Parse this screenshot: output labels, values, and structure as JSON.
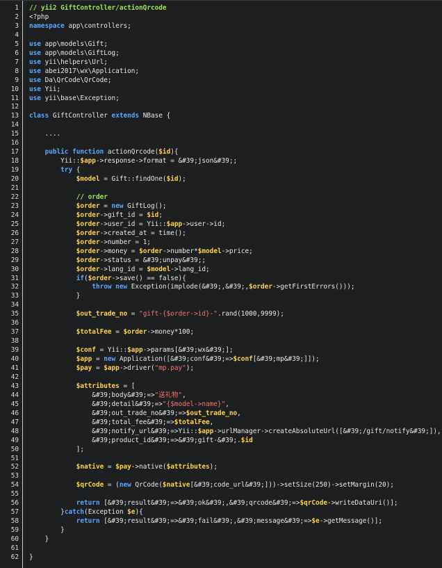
{
  "editor": {
    "colors": {
      "background": "#1d1f21",
      "text": "#e6e6e6",
      "keyword": "#59a8ff",
      "variable": "#ffd24a",
      "string": "#f4746a",
      "comment": "#9be84f",
      "line_number": "#d8d8d8"
    },
    "lines": [
      {
        "n": "1",
        "seg": [
          [
            "cm",
            "// yii2 GiftController/actionQrcode"
          ]
        ]
      },
      {
        "n": "2",
        "seg": [
          [
            "pl",
            "<?php"
          ]
        ]
      },
      {
        "n": "3",
        "seg": [
          [
            "kw",
            "namespace"
          ],
          [
            "pl",
            " app\\controllers;"
          ]
        ]
      },
      {
        "n": "4",
        "seg": []
      },
      {
        "n": "5",
        "seg": [
          [
            "kw",
            "use"
          ],
          [
            "pl",
            " app\\models\\Gift;"
          ]
        ]
      },
      {
        "n": "6",
        "seg": [
          [
            "kw",
            "use"
          ],
          [
            "pl",
            " app\\models\\GiftLog;"
          ]
        ]
      },
      {
        "n": "7",
        "seg": [
          [
            "kw",
            "use"
          ],
          [
            "pl",
            " yii\\helpers\\Url;"
          ]
        ]
      },
      {
        "n": "8",
        "seg": [
          [
            "kw",
            "use"
          ],
          [
            "pl",
            " abei2017\\wx\\Application;"
          ]
        ]
      },
      {
        "n": "9",
        "seg": [
          [
            "kw",
            "use"
          ],
          [
            "pl",
            " Da\\QrCode\\QrCode;"
          ]
        ]
      },
      {
        "n": "10",
        "seg": [
          [
            "kw",
            "use"
          ],
          [
            "pl",
            " Yii;"
          ]
        ]
      },
      {
        "n": "11",
        "seg": [
          [
            "kw",
            "use"
          ],
          [
            "pl",
            " yii\\base\\Exception;"
          ]
        ]
      },
      {
        "n": "12",
        "seg": []
      },
      {
        "n": "13",
        "seg": [
          [
            "kw",
            "class"
          ],
          [
            "pl",
            " GiftController "
          ],
          [
            "kw",
            "extends"
          ],
          [
            "pl",
            " NBase {"
          ]
        ]
      },
      {
        "n": "14",
        "seg": []
      },
      {
        "n": "15",
        "seg": [
          [
            "pl",
            "    ...."
          ]
        ]
      },
      {
        "n": "16",
        "seg": []
      },
      {
        "n": "17",
        "seg": [
          [
            "pl",
            "    "
          ],
          [
            "kw",
            "public function"
          ],
          [
            "pl",
            " actionQrcode("
          ],
          [
            "var",
            "$id"
          ],
          [
            "pl",
            "){"
          ]
        ]
      },
      {
        "n": "18",
        "seg": [
          [
            "pl",
            "        Yii::"
          ],
          [
            "var",
            "$app"
          ],
          [
            "pl",
            "->response->format = &#39;json&#39;;"
          ]
        ]
      },
      {
        "n": "19",
        "seg": [
          [
            "pl",
            "        "
          ],
          [
            "kw",
            "try"
          ],
          [
            "pl",
            " {"
          ]
        ]
      },
      {
        "n": "20",
        "seg": [
          [
            "pl",
            "            "
          ],
          [
            "var",
            "$model"
          ],
          [
            "pl",
            " = Gift::findOne("
          ],
          [
            "var",
            "$id"
          ],
          [
            "pl",
            ");"
          ]
        ]
      },
      {
        "n": "21",
        "seg": []
      },
      {
        "n": "22",
        "seg": [
          [
            "pl",
            "            "
          ],
          [
            "cm",
            "// order"
          ]
        ]
      },
      {
        "n": "23",
        "seg": [
          [
            "pl",
            "            "
          ],
          [
            "var",
            "$order"
          ],
          [
            "pl",
            " = "
          ],
          [
            "kw",
            "new"
          ],
          [
            "pl",
            " GiftLog();"
          ]
        ]
      },
      {
        "n": "24",
        "seg": [
          [
            "pl",
            "            "
          ],
          [
            "var",
            "$order"
          ],
          [
            "pl",
            "->gift_id = "
          ],
          [
            "var",
            "$id"
          ],
          [
            "pl",
            ";"
          ]
        ]
      },
      {
        "n": "25",
        "seg": [
          [
            "pl",
            "            "
          ],
          [
            "var",
            "$order"
          ],
          [
            "pl",
            "->user_id = Yii::"
          ],
          [
            "var",
            "$app"
          ],
          [
            "pl",
            "->user->id;"
          ]
        ]
      },
      {
        "n": "26",
        "seg": [
          [
            "pl",
            "            "
          ],
          [
            "var",
            "$order"
          ],
          [
            "pl",
            "->created_at = time();"
          ]
        ]
      },
      {
        "n": "27",
        "seg": [
          [
            "pl",
            "            "
          ],
          [
            "var",
            "$order"
          ],
          [
            "pl",
            "->number = 1;"
          ]
        ]
      },
      {
        "n": "28",
        "seg": [
          [
            "pl",
            "            "
          ],
          [
            "var",
            "$order"
          ],
          [
            "pl",
            "->money = "
          ],
          [
            "var",
            "$order"
          ],
          [
            "pl",
            "->number*"
          ],
          [
            "var",
            "$model"
          ],
          [
            "pl",
            "->price;"
          ]
        ]
      },
      {
        "n": "29",
        "seg": [
          [
            "pl",
            "            "
          ],
          [
            "var",
            "$order"
          ],
          [
            "pl",
            "->status = &#39;unpay&#39;;"
          ]
        ]
      },
      {
        "n": "30",
        "seg": [
          [
            "pl",
            "            "
          ],
          [
            "var",
            "$order"
          ],
          [
            "pl",
            "->lang_id = "
          ],
          [
            "var",
            "$model"
          ],
          [
            "pl",
            "->lang_id;"
          ]
        ]
      },
      {
        "n": "31",
        "seg": [
          [
            "pl",
            "            "
          ],
          [
            "kw",
            "if"
          ],
          [
            "pl",
            "("
          ],
          [
            "var",
            "$order"
          ],
          [
            "pl",
            "->save() == false){"
          ]
        ]
      },
      {
        "n": "32",
        "seg": [
          [
            "pl",
            "                "
          ],
          [
            "kw",
            "throw new"
          ],
          [
            "pl",
            " Exception(implode(&#39;,&#39;,"
          ],
          [
            "var",
            "$order"
          ],
          [
            "pl",
            "->getFirstErrors()));"
          ]
        ]
      },
      {
        "n": "33",
        "seg": [
          [
            "pl",
            "            }"
          ]
        ]
      },
      {
        "n": "34",
        "seg": []
      },
      {
        "n": "35",
        "seg": [
          [
            "pl",
            "            "
          ],
          [
            "var",
            "$out_trade_no"
          ],
          [
            "pl",
            " = "
          ],
          [
            "str",
            "\"gift-{$order->id}-\""
          ],
          [
            "pl",
            ".rand(1000,9999);"
          ]
        ]
      },
      {
        "n": "36",
        "seg": []
      },
      {
        "n": "37",
        "seg": [
          [
            "pl",
            "            "
          ],
          [
            "var",
            "$totalFee"
          ],
          [
            "pl",
            " = "
          ],
          [
            "var",
            "$order"
          ],
          [
            "pl",
            "->money*100;"
          ]
        ]
      },
      {
        "n": "38",
        "seg": []
      },
      {
        "n": "39",
        "seg": [
          [
            "pl",
            "            "
          ],
          [
            "var",
            "$conf"
          ],
          [
            "pl",
            " = Yii::"
          ],
          [
            "var",
            "$app"
          ],
          [
            "pl",
            "->params[&#39;wx&#39;];"
          ]
        ]
      },
      {
        "n": "40",
        "seg": [
          [
            "pl",
            "            "
          ],
          [
            "var",
            "$app"
          ],
          [
            "pl",
            " = "
          ],
          [
            "kw",
            "new"
          ],
          [
            "pl",
            " Application([&#39;conf&#39;=>"
          ],
          [
            "var",
            "$conf"
          ],
          [
            "pl",
            "[&#39;mp&#39;]]);"
          ]
        ]
      },
      {
        "n": "41",
        "seg": [
          [
            "pl",
            "            "
          ],
          [
            "var",
            "$pay"
          ],
          [
            "pl",
            " = "
          ],
          [
            "var",
            "$app"
          ],
          [
            "pl",
            "->driver("
          ],
          [
            "str",
            "\"mp.pay\""
          ],
          [
            "pl",
            ");"
          ]
        ]
      },
      {
        "n": "42",
        "seg": []
      },
      {
        "n": "43",
        "seg": [
          [
            "pl",
            "            "
          ],
          [
            "var",
            "$attributes"
          ],
          [
            "pl",
            " = ["
          ]
        ]
      },
      {
        "n": "44",
        "seg": [
          [
            "pl",
            "                &#39;body&#39;=>"
          ],
          [
            "str",
            "\"送礼物\""
          ],
          [
            "pl",
            ","
          ]
        ]
      },
      {
        "n": "45",
        "seg": [
          [
            "pl",
            "                &#39;detail&#39;=>"
          ],
          [
            "str",
            "\"{$model->name}\""
          ],
          [
            "pl",
            ","
          ]
        ]
      },
      {
        "n": "46",
        "seg": [
          [
            "pl",
            "                &#39;out_trade_no&#39;=>"
          ],
          [
            "var",
            "$out_trade_no"
          ],
          [
            "pl",
            ","
          ]
        ]
      },
      {
        "n": "47",
        "seg": [
          [
            "pl",
            "                &#39;total_fee&#39;=>"
          ],
          [
            "var",
            "$totalFee"
          ],
          [
            "pl",
            ","
          ]
        ]
      },
      {
        "n": "48",
        "seg": [
          [
            "pl",
            "                &#39;notify_url&#39;=>Yii::"
          ],
          [
            "var",
            "$app"
          ],
          [
            "pl",
            "->urlManager->createAbsoluteUrl([&#39;/gift/notify&#39;]),"
          ]
        ]
      },
      {
        "n": "49",
        "seg": [
          [
            "pl",
            "                &#39;product_id&#39;=>&#39;gift-&#39;."
          ],
          [
            "var",
            "$id"
          ]
        ]
      },
      {
        "n": "50",
        "seg": [
          [
            "pl",
            "            ];"
          ]
        ]
      },
      {
        "n": "51",
        "seg": []
      },
      {
        "n": "52",
        "seg": [
          [
            "pl",
            "            "
          ],
          [
            "var",
            "$native"
          ],
          [
            "pl",
            " = "
          ],
          [
            "var",
            "$pay"
          ],
          [
            "pl",
            "->native("
          ],
          [
            "var",
            "$attributes"
          ],
          [
            "pl",
            ");"
          ]
        ]
      },
      {
        "n": "53",
        "seg": []
      },
      {
        "n": "54",
        "seg": [
          [
            "pl",
            "            "
          ],
          [
            "var",
            "$qrCode"
          ],
          [
            "pl",
            " = ("
          ],
          [
            "kw",
            "new"
          ],
          [
            "pl",
            " QrCode("
          ],
          [
            "var",
            "$native"
          ],
          [
            "pl",
            "[&#39;code_url&#39;]))->setSize(250)->setMargin(20);"
          ]
        ]
      },
      {
        "n": "55",
        "seg": []
      },
      {
        "n": "56",
        "seg": [
          [
            "pl",
            "            "
          ],
          [
            "kw",
            "return"
          ],
          [
            "pl",
            " [&#39;result&#39;=>&#39;ok&#39;,&#39;qrcode&#39;=>"
          ],
          [
            "var",
            "$qrCode"
          ],
          [
            "pl",
            "->writeDataUri()];"
          ]
        ]
      },
      {
        "n": "57",
        "seg": [
          [
            "pl",
            "        }"
          ],
          [
            "kw",
            "catch"
          ],
          [
            "pl",
            "(Exception "
          ],
          [
            "var",
            "$e"
          ],
          [
            "pl",
            "){"
          ]
        ]
      },
      {
        "n": "58",
        "seg": [
          [
            "pl",
            "            "
          ],
          [
            "kw",
            "return"
          ],
          [
            "pl",
            " [&#39;result&#39;=>&#39;fail&#39;,&#39;message&#39;=>"
          ],
          [
            "var",
            "$e"
          ],
          [
            "pl",
            "->getMessage()];"
          ]
        ]
      },
      {
        "n": "59",
        "seg": [
          [
            "pl",
            "        }"
          ]
        ]
      },
      {
        "n": "60",
        "seg": [
          [
            "pl",
            "    }"
          ]
        ]
      },
      {
        "n": "61",
        "seg": []
      },
      {
        "n": "62",
        "seg": [
          [
            "pl",
            "}"
          ]
        ]
      }
    ]
  }
}
